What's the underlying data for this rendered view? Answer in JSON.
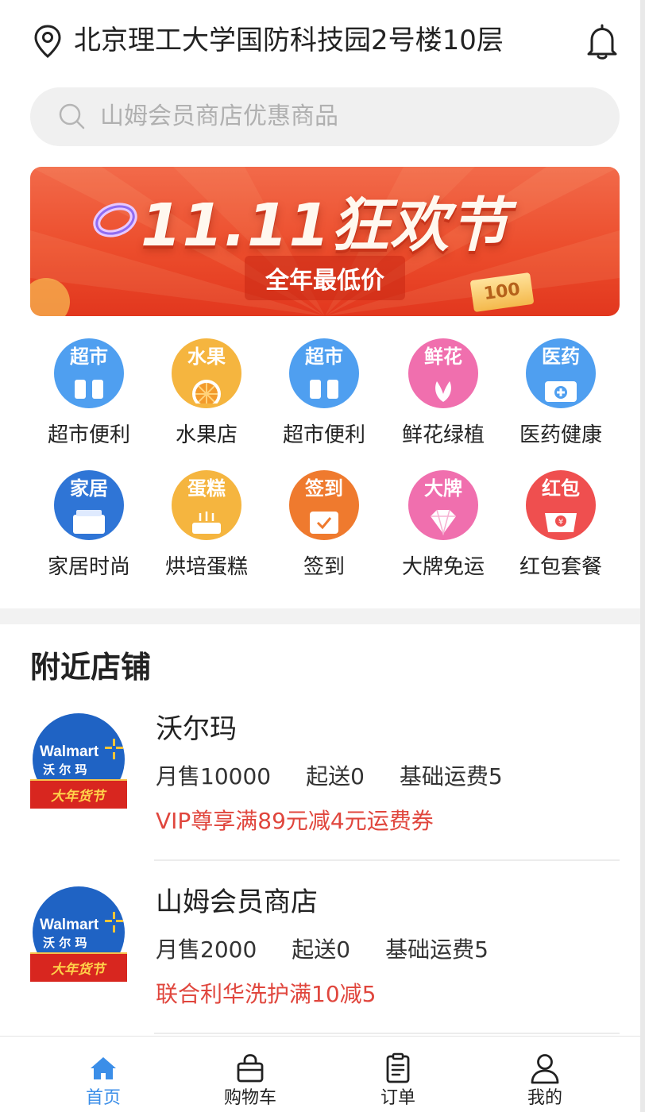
{
  "header": {
    "location": "北京理工大学国防科技园2号楼10层",
    "location_icon": "map-pin-icon",
    "bell_icon": "bell-icon"
  },
  "search": {
    "placeholder": "山姆会员商店优惠商品",
    "icon": "search-icon"
  },
  "banner": {
    "title": "11.11狂欢节",
    "subtitle": "全年最低价",
    "ticket": "100",
    "colors": {
      "top": "#f26a4a",
      "bottom": "#e2371e"
    }
  },
  "categories": [
    {
      "tag": "超市",
      "label": "超市便利",
      "color": "#4f9ff0",
      "icon": "supermarket-icon"
    },
    {
      "tag": "水果",
      "label": "水果店",
      "color": "#f5b53f",
      "icon": "fruit-icon"
    },
    {
      "tag": "超市",
      "label": "超市便利",
      "color": "#4f9ff0",
      "icon": "supermarket-icon"
    },
    {
      "tag": "鲜花",
      "label": "鲜花绿植",
      "color": "#f06fae",
      "icon": "flower-icon"
    },
    {
      "tag": "医药",
      "label": "医药健康",
      "color": "#4f9ff0",
      "icon": "medicine-icon"
    },
    {
      "tag": "家居",
      "label": "家居时尚",
      "color": "#2f75d6",
      "icon": "home-icon"
    },
    {
      "tag": "蛋糕",
      "label": "烘培蛋糕",
      "color": "#f5b53f",
      "icon": "cake-icon"
    },
    {
      "tag": "签到",
      "label": "签到",
      "color": "#ef7a2e",
      "icon": "checkin-icon"
    },
    {
      "tag": "大牌",
      "label": "大牌免运",
      "color": "#f06fae",
      "icon": "diamond-icon"
    },
    {
      "tag": "红包",
      "label": "红包套餐",
      "color": "#ef4f4f",
      "icon": "red-packet-icon"
    }
  ],
  "nearby": {
    "title": "附近店铺",
    "stores": [
      {
        "name": "沃尔玛",
        "monthly_sales": "月售10000",
        "min_order": "起送0",
        "delivery_fee": "基础运费5",
        "promo": "VIP尊享满89元减4元运费券",
        "logo_brand": "Walmart",
        "logo_cn": "沃 尔 玛",
        "logo_ribbon": "大年货节"
      },
      {
        "name": "山姆会员商店",
        "monthly_sales": "月售2000",
        "min_order": "起送0",
        "delivery_fee": "基础运费5",
        "promo": "联合利华洗护满10减5",
        "logo_brand": "Walmart",
        "logo_cn": "沃 尔 玛",
        "logo_ribbon": "大年货节"
      }
    ]
  },
  "tabbar": {
    "active_color": "#3b8ee8",
    "items": [
      {
        "label": "首页",
        "icon": "home-tab-icon",
        "active": true
      },
      {
        "label": "购物车",
        "icon": "shopping-bag-icon",
        "active": false
      },
      {
        "label": "订单",
        "icon": "order-list-icon",
        "active": false
      },
      {
        "label": "我的",
        "icon": "user-icon",
        "active": false
      }
    ]
  }
}
